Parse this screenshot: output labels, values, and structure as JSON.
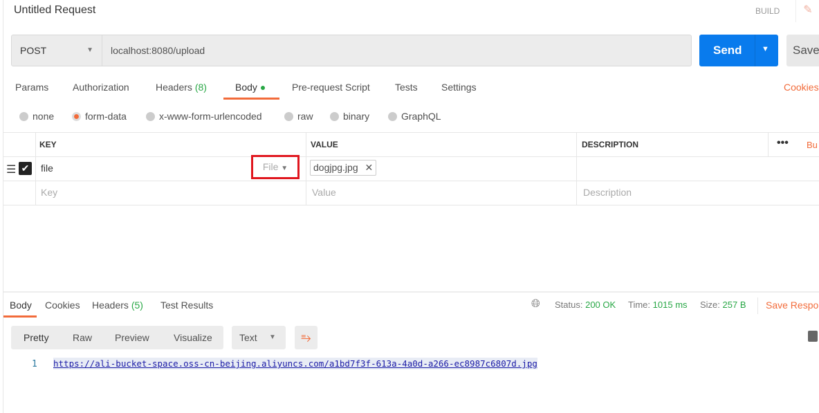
{
  "header": {
    "title": "Untitled Request",
    "build": "BUILD"
  },
  "request": {
    "method": "POST",
    "url": "localhost:8080/upload",
    "send": "Send",
    "save": "Save"
  },
  "tabs": [
    {
      "label": "Params"
    },
    {
      "label": "Authorization"
    },
    {
      "label": "Headers",
      "count": "(8)"
    },
    {
      "label": "Body"
    },
    {
      "label": "Pre-request Script"
    },
    {
      "label": "Tests"
    },
    {
      "label": "Settings"
    }
  ],
  "cookies": "Cookies",
  "body_types": [
    "none",
    "form-data",
    "x-www-form-urlencoded",
    "raw",
    "binary",
    "GraphQL"
  ],
  "selected_body_type": "form-data",
  "table": {
    "headers": [
      "KEY",
      "VALUE",
      "DESCRIPTION"
    ],
    "bulk": "Bu",
    "rows": [
      {
        "key": "file",
        "type": "File",
        "value": "dogjpg.jpg",
        "checked": true
      }
    ],
    "placeholders": {
      "key": "Key",
      "value": "Value",
      "description": "Description"
    }
  },
  "response": {
    "tabs": [
      {
        "label": "Body"
      },
      {
        "label": "Cookies"
      },
      {
        "label": "Headers",
        "count": "(5)"
      },
      {
        "label": "Test Results"
      }
    ],
    "status_label": "Status:",
    "status": "200 OK",
    "time_label": "Time:",
    "time": "1015 ms",
    "size_label": "Size:",
    "size": "257 B",
    "save": "Save Respo",
    "views": [
      "Pretty",
      "Raw",
      "Preview",
      "Visualize"
    ],
    "format": "Text",
    "lines": [
      {
        "n": "1",
        "text": "https://ali-bucket-space.oss-cn-beijing.aliyuncs.com/a1bd7f3f-613a-4a0d-a266-ec8987c6807d.jpg"
      }
    ]
  },
  "colors": {
    "accent": "#f26b3a",
    "send": "#097bed",
    "success": "#28a745",
    "highlight": "#e0161e"
  }
}
